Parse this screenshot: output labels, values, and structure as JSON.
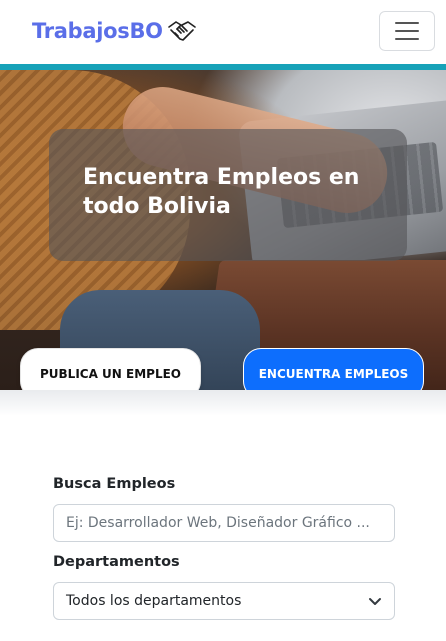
{
  "navbar": {
    "brand_text": "TrabajosBO",
    "brand_icon": "handshake-icon",
    "menu_icon": "hamburger-icon"
  },
  "hero": {
    "title": "Encuentra Empleos en todo Bolivia",
    "publish_button_label": "PUBLICA UN EMPLEO",
    "find_button_label": "ENCUENTRA EMPLEOS"
  },
  "search": {
    "label": "Busca Empleos",
    "placeholder": "Ej: Desarrollador Web, Diseñador Gráfico ..."
  },
  "departments": {
    "label": "Departamentos",
    "selected": "Todos los departamentos"
  },
  "colors": {
    "brand": "#5a6ee8",
    "accent_strip": "#17a2b8",
    "primary_button": "#0d6efd"
  }
}
